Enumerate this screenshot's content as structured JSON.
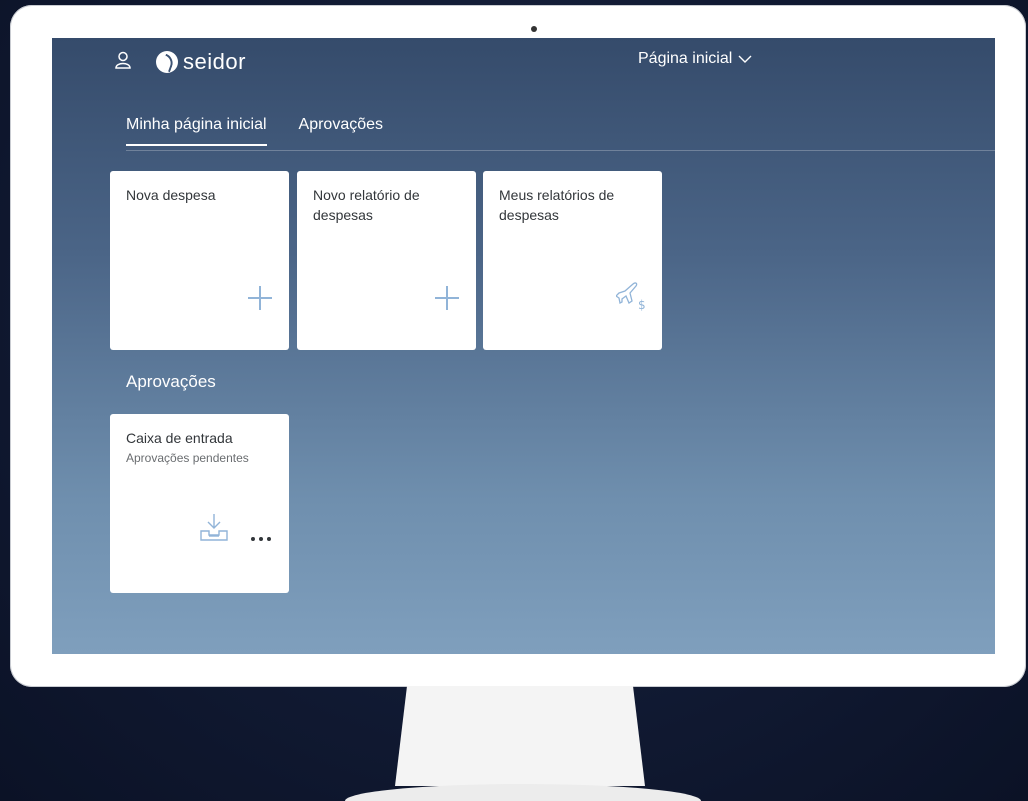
{
  "header": {
    "logo_text": "seidor",
    "page_title": "Página inicial"
  },
  "tabs": [
    {
      "label": "Minha página inicial",
      "active": true
    },
    {
      "label": "Aprovações",
      "active": false
    }
  ],
  "tiles": [
    {
      "title": "Nova despesa",
      "icon": "add-icon"
    },
    {
      "title": "Novo relatório de despesas",
      "icon": "add-icon"
    },
    {
      "title": "Meus relatórios de despesas",
      "icon": "travel-expense-icon"
    }
  ],
  "approvals": {
    "section_title": "Aprovações",
    "tile": {
      "title": "Caixa de entrada",
      "subtitle": "Aprovações pendentes",
      "icon": "inbox-download-icon"
    }
  },
  "colors": {
    "icon_blue": "#91b4d8",
    "tile_text": "#32363a"
  }
}
